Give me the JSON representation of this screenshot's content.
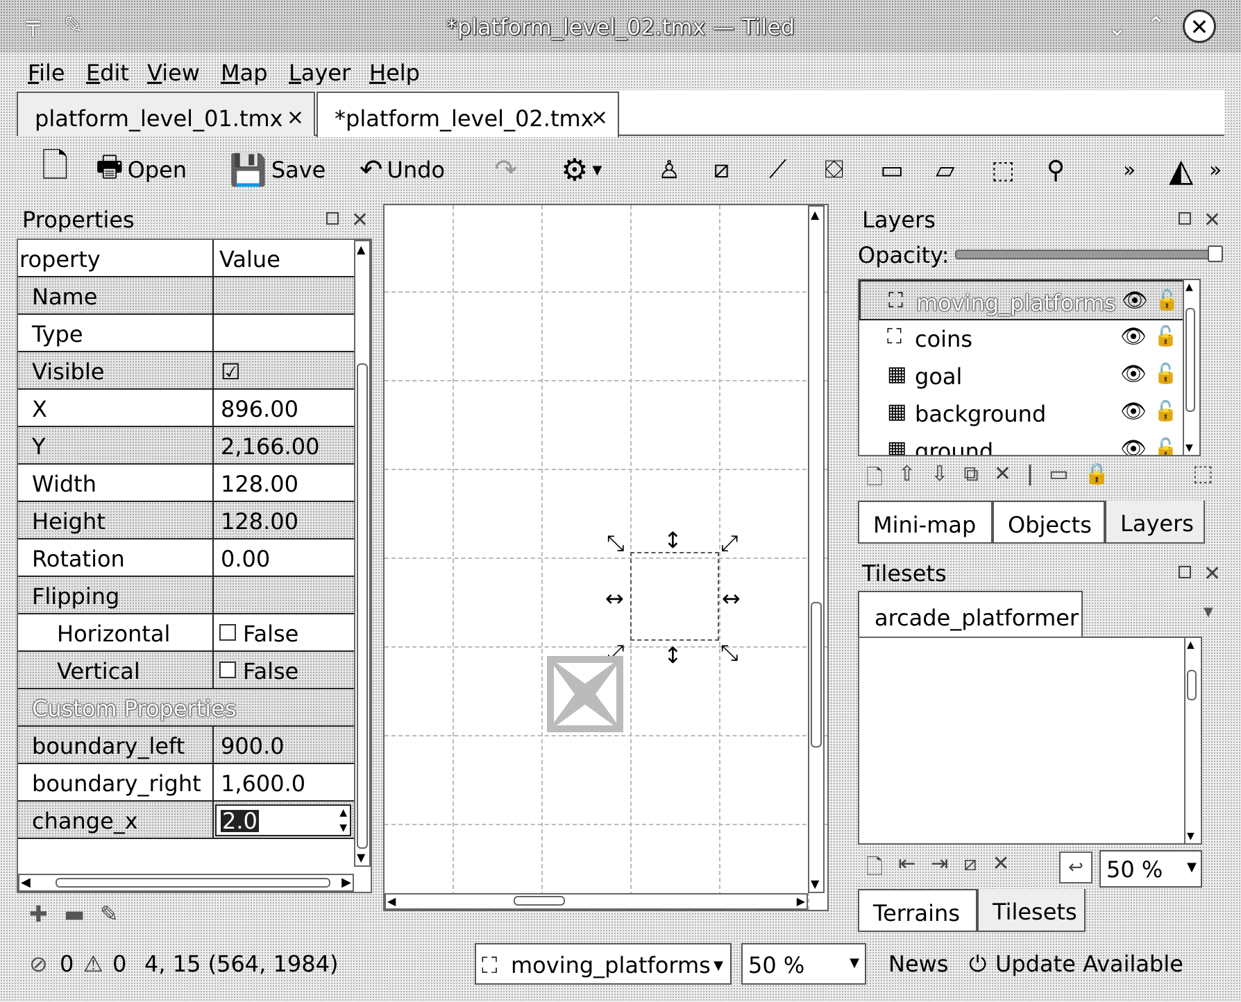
{
  "window": {
    "title": "*platform_level_02.tmx — Tiled"
  },
  "menu": [
    "File",
    "Edit",
    "View",
    "Map",
    "Layer",
    "Help"
  ],
  "menu_mnemonic": [
    "F",
    "E",
    "V",
    "M",
    "L",
    "H"
  ],
  "menu_rest": [
    "ile",
    "dit",
    "iew",
    "ap",
    "ayer",
    "elp"
  ],
  "tabs": [
    {
      "label": "platform_level_01.tmx"
    },
    {
      "label": "*platform_level_02.tmx"
    }
  ],
  "toolbar": {
    "open": "Open",
    "save": "Save",
    "undo": "Undo"
  },
  "properties": {
    "title": "Properties",
    "col_property": "roperty",
    "col_value": "Value",
    "rows": [
      {
        "name": "Name",
        "value": ""
      },
      {
        "name": "Type",
        "value": ""
      },
      {
        "name": "Visible",
        "value": "☑"
      },
      {
        "name": "X",
        "value": "896.00"
      },
      {
        "name": "Y",
        "value": "2,166.00"
      },
      {
        "name": "Width",
        "value": "128.00"
      },
      {
        "name": "Height",
        "value": "128.00"
      },
      {
        "name": "Rotation",
        "value": "0.00"
      },
      {
        "name": "Flipping",
        "value": ""
      },
      {
        "name": "Horizontal",
        "value": "False"
      },
      {
        "name": "Vertical",
        "value": "False"
      }
    ],
    "custom_header": "Custom Properties",
    "custom_rows": [
      {
        "name": "boundary_left",
        "value": "900.0"
      },
      {
        "name": "boundary_right",
        "value": "1,600.0"
      },
      {
        "name": "change_x",
        "value": "2.0"
      }
    ]
  },
  "layers": {
    "title": "Layers",
    "opacity_label": "Opacity:",
    "opacity": 1.0,
    "items": [
      {
        "name": "moving_platforms",
        "selected": true
      },
      {
        "name": "coins",
        "selected": false
      },
      {
        "name": "goal",
        "selected": false
      },
      {
        "name": "background",
        "selected": false
      },
      {
        "name": "ground",
        "selected": false
      }
    ],
    "tabs": [
      "Mini-map",
      "Objects",
      "Layers"
    ]
  },
  "tilesets": {
    "title": "Tilesets",
    "active_tab": "arcade_platformer",
    "zoom": "50 %",
    "tabs": [
      "Terrains",
      "Tilesets"
    ]
  },
  "status": {
    "errors": "0",
    "warnings": "0",
    "coords": "4, 15 (564, 1984)",
    "layer": "moving_platforms",
    "zoom": "50 %",
    "news": "News",
    "update": "Update Available"
  },
  "colors": {
    "selection_highlight": "#ffffff",
    "border": "#222222"
  }
}
